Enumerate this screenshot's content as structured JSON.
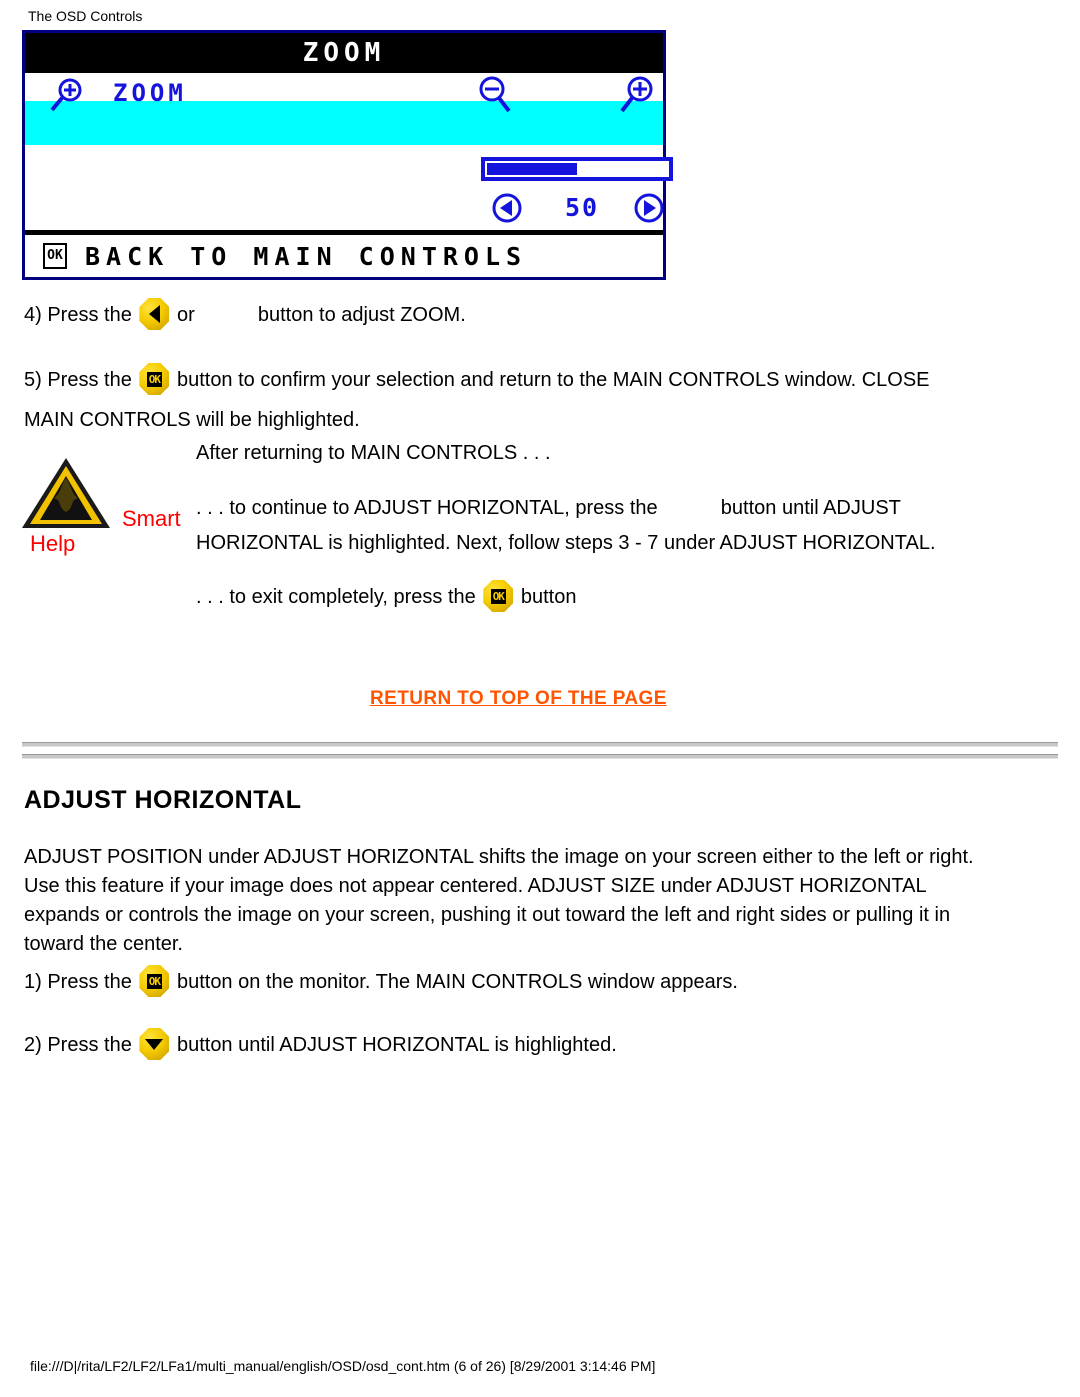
{
  "page": {
    "title": "The OSD Controls",
    "footer_path": "file:///D|/rita/LF2/LF2/LFa1/multi_manual/english/OSD/osd_cont.htm (6 of 26) [8/29/2001 3:14:46 PM]"
  },
  "osd": {
    "window_title": "ZOOM",
    "row_label": "ZOOM",
    "row_icon": "magnifier-plus-icon",
    "decrease_icon": "magnifier-minus-icon",
    "increase_icon": "magnifier-plus-icon",
    "value": "50",
    "slider_percent": 50,
    "left_arrow_icon": "left-arrow-icon",
    "right_arrow_icon": "right-arrow-icon",
    "footer_ok_icon": "ok-box-icon",
    "footer_label": "BACK TO MAIN CONTROLS",
    "colors": {
      "highlight": "#00FFFF",
      "accent_blue": "#1414DC",
      "titlebar": "#000000",
      "border": "#000080"
    }
  },
  "steps": {
    "step4": {
      "prefix": "4) Press the",
      "middle": "or",
      "suffix": "button to adjust ZOOM.",
      "icon1": "left-arrow-button",
      "icon2_missing": true
    },
    "step5": {
      "prefix": "5) Press the",
      "suffix": "button to confirm your selection and return to the MAIN CONTROLS window. CLOSE",
      "line2": "MAIN CONTROLS will be highlighted.",
      "icon": "ok-button"
    },
    "adjust_step1": {
      "prefix": "1) Press the",
      "suffix": "button on the monitor. The MAIN CONTROLS window appears.",
      "icon": "ok-button"
    },
    "adjust_step2": {
      "prefix": "2) Press the",
      "suffix": "button until ADJUST HORIZONTAL is highlighted.",
      "icon": "down-arrow-button"
    }
  },
  "smart_help": {
    "icon": "warning-triangle-icon",
    "word_smart": "Smart",
    "word_help": "Help",
    "color": "#FF0000",
    "line1": "After returning to MAIN CONTROLS . . .",
    "line2_prefix": ". . . to continue to ADJUST HORIZONTAL, press the",
    "line2_suffix": "button until ADJUST",
    "line3": "HORIZONTAL is highlighted. Next, follow steps 3 - 7 under ADJUST HORIZONTAL.",
    "line4_prefix": ". . . to exit completely, press the",
    "line4_suffix": "button",
    "line4_icon": "ok-button"
  },
  "return_link": {
    "label": "RETURN TO TOP OF THE PAGE",
    "color": "#FF5500"
  },
  "adjust_section": {
    "heading": "ADJUST HORIZONTAL",
    "body_line1": "ADJUST POSITION under ADJUST HORIZONTAL shifts the image on your screen either to the left or right.",
    "body_line2": "Use this feature if your image does not appear centered. ADJUST SIZE under ADJUST HORIZONTAL",
    "body_line3": "expands or controls the image on your screen, pushing it out toward the left and right sides or pulling it in",
    "body_line4": "toward the center."
  }
}
